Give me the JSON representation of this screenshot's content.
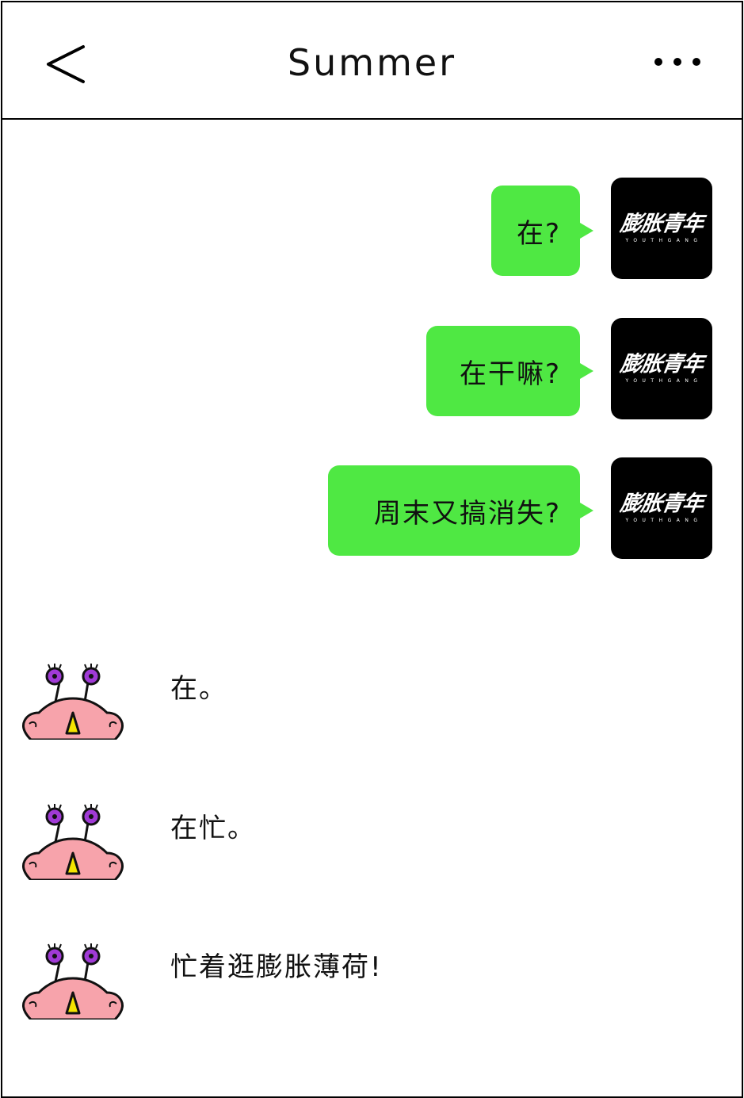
{
  "header": {
    "title": "Summer",
    "back_icon": "chevron-left-icon",
    "more_icon": "more-dots-icon"
  },
  "contact_logo": {
    "main": "膨胀青年",
    "sub": "YOUTHGANG"
  },
  "colors": {
    "bubble_out": "#4fe843",
    "avatar_me_bg": "#000000",
    "monster_body": "#f7a3ab",
    "monster_eye": "#a03ad6",
    "monster_nose": "#f5e400"
  },
  "messages_out": [
    {
      "text": "在?"
    },
    {
      "text": "在干嘛?"
    },
    {
      "text": "周末又搞消失?"
    }
  ],
  "messages_in": [
    {
      "text": "在。"
    },
    {
      "text": "在忙。"
    },
    {
      "text": "忙着逛膨胀薄荷!"
    }
  ]
}
